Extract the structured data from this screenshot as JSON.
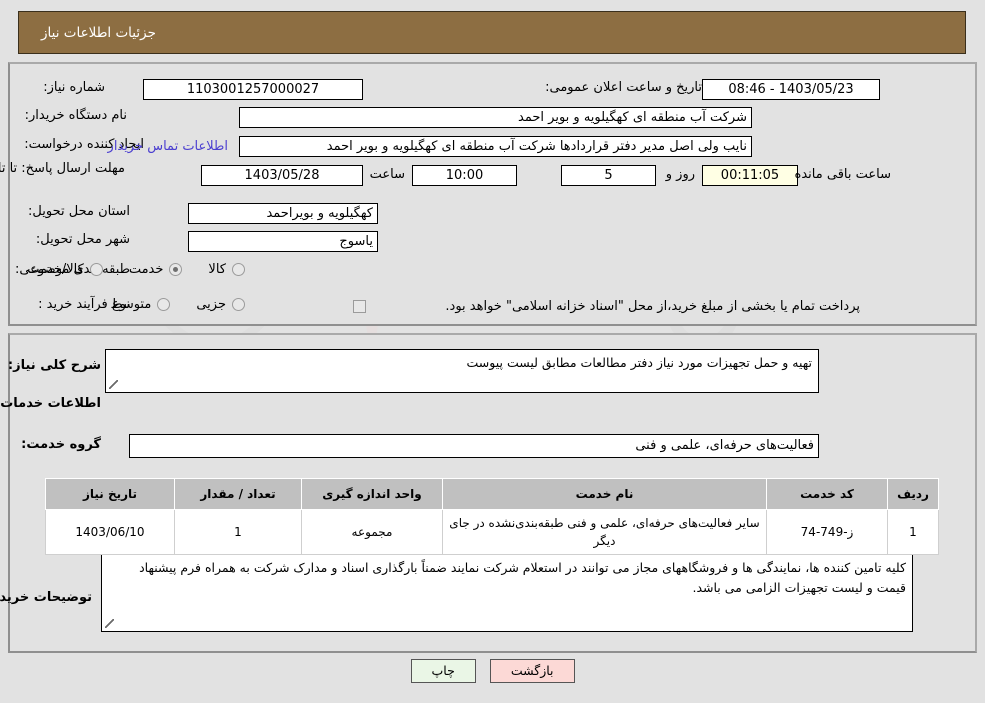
{
  "header": {
    "title": "جزئیات اطلاعات نیاز"
  },
  "form": {
    "need_number_label": "شماره نیاز:",
    "need_number_value": "1103001257000027",
    "public_announce_label": "تاریخ و ساعت اعلان عمومی:",
    "public_announce_value": "1403/05/23 - 08:46",
    "buyer_org_label": "نام دستگاه خریدار:",
    "buyer_org_value": "شرکت آب منطقه ای کهگیلویه و بویر احمد",
    "creator_label": "ایجاد کننده درخواست:",
    "creator_value": "نایب ولی اصل مدیر دفتر قراردادها شرکت آب منطقه ای کهگیلویه و بویر احمد",
    "contact_link": "اطلاعات تماس خریدار",
    "deadline_label": "مهلت ارسال پاسخ: تا تاریخ:",
    "deadline_date": "1403/05/28",
    "hour_label": "ساعت",
    "deadline_time": "10:00",
    "days_value": "5",
    "days_label": "روز و",
    "countdown_value": "00:11:05",
    "remaining_label": "ساعت باقی مانده",
    "province_label": "استان محل تحویل:",
    "province_value": "کهگیلویه و بویراحمد",
    "city_label": "شهر محل تحویل:",
    "city_value": "یاسوج",
    "category_label": "طبقه بندی موضوعی:",
    "category_options": [
      {
        "label": "کالا",
        "selected": false
      },
      {
        "label": "خدمت",
        "selected": true
      },
      {
        "label": "کالا/خدمت",
        "selected": false
      }
    ],
    "process_label": "نوع فرآیند خرید :",
    "process_options": [
      {
        "label": "جزیی",
        "selected": false
      },
      {
        "label": "متوسط",
        "selected": false
      }
    ],
    "treasury_checkbox_checked": false,
    "treasury_text": "پرداخت تمام یا بخشی از مبلغ خرید،از محل \"اسناد خزانه اسلامی\" خواهد بود."
  },
  "body": {
    "general_desc_label": "شرح کلی نیاز:",
    "general_desc_value": "تهیه و حمل تجهیزات مورد نیاز دفتر مطالعات مطابق لیست پیوست",
    "services_heading": "اطلاعات خدمات مورد نیاز",
    "service_group_label": "گروه خدمت:",
    "service_group_value": "فعالیت‌های حرفه‌ای، علمی و فنی",
    "buyer_notes_label": "توضیحات خریدار:",
    "buyer_notes_value": "کلیه تامین کننده ها، نمایندگی ها  و فروشگاههای مجاز می توانند در استعلام شرکت نمایند ضمناً بارگذاری اسناد و مدارک شرکت به همراه فرم پیشنهاد قیمت و لیست تجهیزات الزامی می باشد."
  },
  "table": {
    "headers": [
      "ردیف",
      "کد خدمت",
      "نام خدمت",
      "واحد اندازه گیری",
      "تعداد / مقدار",
      "تاریخ نیاز"
    ],
    "rows": [
      {
        "radif": "1",
        "code": "ز-749-74",
        "name": "سایر فعالیت‌های حرفه‌ای، علمی و فنی طبقه‌بندی‌نشده در جای دیگر",
        "unit": "مجموعه",
        "qty": "1",
        "date": "1403/06/10"
      }
    ]
  },
  "buttons": {
    "print": "چاپ",
    "back": "بازگشت"
  },
  "colors": {
    "header_bg": "#8d6e42",
    "page_bg": "#e2e2e2",
    "link": "#4b3fd0",
    "table_header_bg": "#c0c0c0",
    "print_btn_bg": "#eaf6e6",
    "back_btn_bg": "#fcd9d6",
    "countdown_bg": "#ffffe4"
  },
  "watermark": {
    "text": "AriaTender.net"
  }
}
